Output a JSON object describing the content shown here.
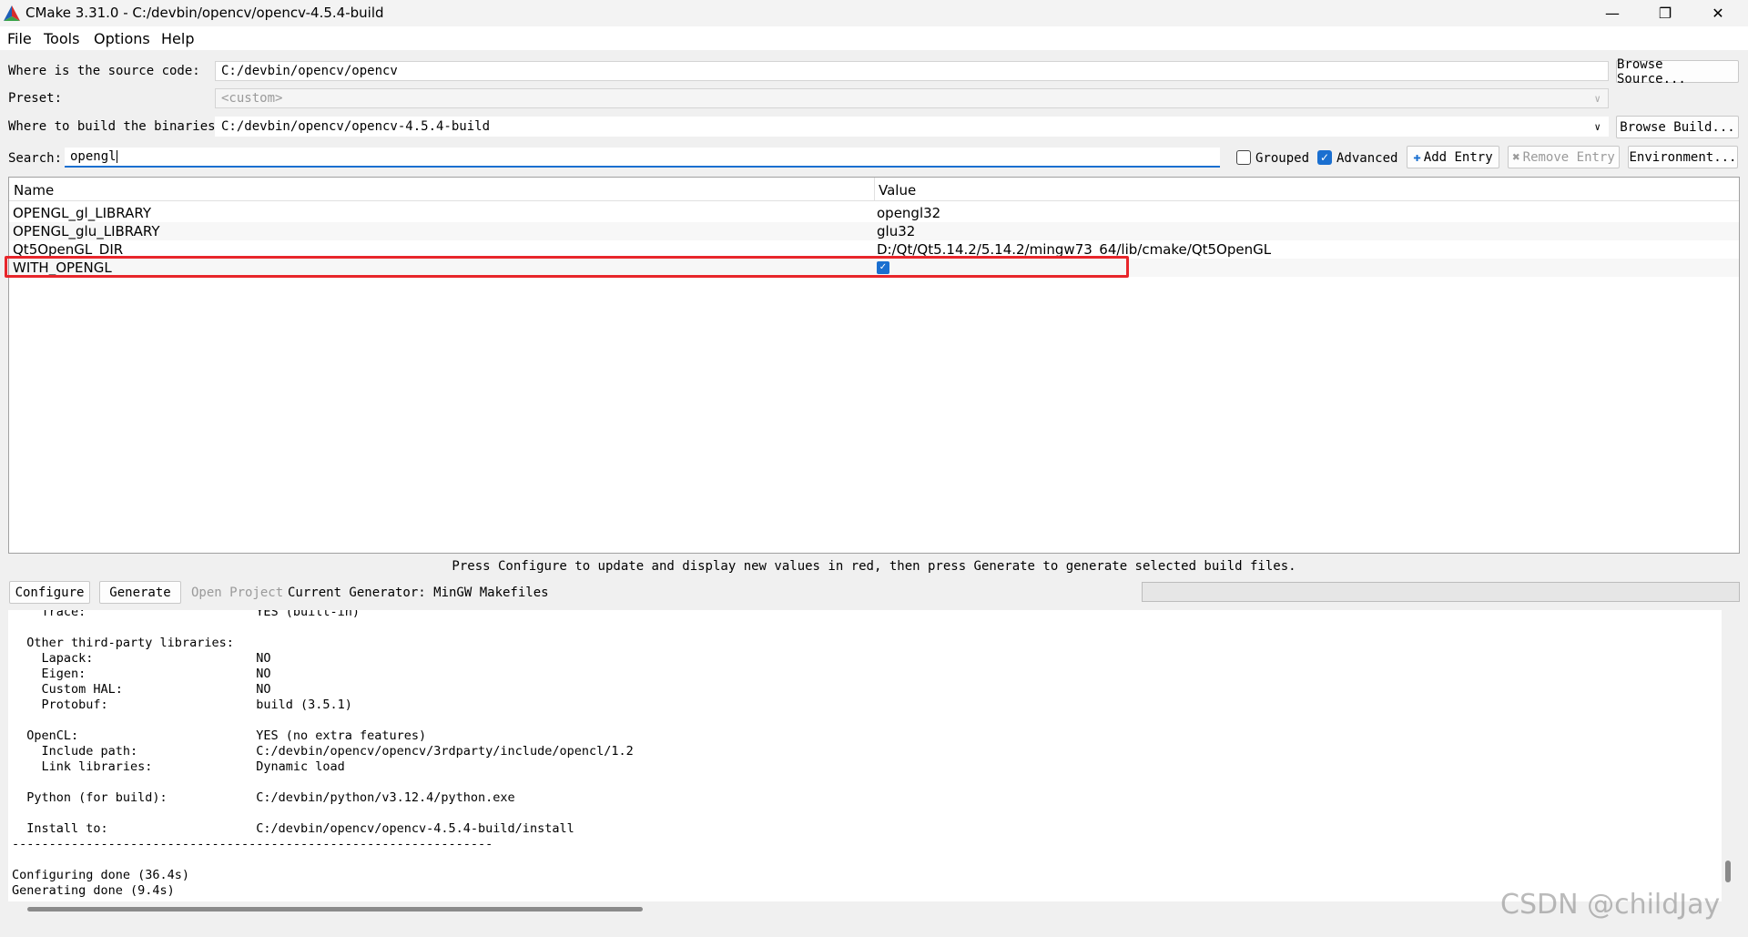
{
  "window": {
    "title": "CMake 3.31.0 - C:/devbin/opencv/opencv-4.5.4-build",
    "minimize_glyph": "—",
    "restore_glyph": "❐",
    "close_glyph": "✕"
  },
  "menubar": {
    "file": "File",
    "tools": "Tools",
    "options": "Options",
    "help": "Help"
  },
  "source": {
    "label": "Where is the source code:",
    "value": "C:/devbin/opencv/opencv",
    "browse": "Browse Source..."
  },
  "preset": {
    "label": "Preset:",
    "value": "<custom>"
  },
  "build": {
    "label": "Where to build the binaries:",
    "value": "C:/devbin/opencv/opencv-4.5.4-build",
    "browse": "Browse Build..."
  },
  "search": {
    "label": "Search:",
    "value": "opengl",
    "grouped_label": "Grouped",
    "grouped_checked": false,
    "advanced_label": "Advanced",
    "advanced_checked": true,
    "add_entry": "Add Entry",
    "remove_entry": "Remove Entry",
    "environment": "Environment..."
  },
  "table": {
    "columns": {
      "name": "Name",
      "value": "Value"
    },
    "rows": [
      {
        "name": "OPENGL_gl_LIBRARY",
        "value": "opengl32"
      },
      {
        "name": "OPENGL_glu_LIBRARY",
        "value": "glu32"
      },
      {
        "name": "Qt5OpenGL_DIR",
        "value": "D:/Qt/Qt5.14.2/5.14.2/mingw73_64/lib/cmake/Qt5OpenGL"
      },
      {
        "name": "WITH_OPENGL",
        "value_checked": true
      }
    ]
  },
  "status": {
    "hint": "Press Configure to update and display new values in red, then press Generate to generate selected build files."
  },
  "actions": {
    "configure": "Configure",
    "generate": "Generate",
    "open_project": "Open Project",
    "current_generator": "Current Generator: MinGW Makefiles"
  },
  "log": {
    "lines": [
      "    Trace:                       YES (built-in)",
      "",
      "  Other third-party libraries:",
      "    Lapack:                      NO",
      "    Eigen:                       NO",
      "    Custom HAL:                  NO",
      "    Protobuf:                    build (3.5.1)",
      "",
      "  OpenCL:                        YES (no extra features)",
      "    Include path:                C:/devbin/opencv/opencv/3rdparty/include/opencl/1.2",
      "    Link libraries:              Dynamic load",
      "",
      "  Python (for build):            C:/devbin/python/v3.12.4/python.exe",
      "",
      "  Install to:                    C:/devbin/opencv/opencv-4.5.4-build/install",
      "-----------------------------------------------------------------",
      "",
      "Configuring done (36.4s)",
      "Generating done (9.4s)"
    ]
  },
  "watermark": "CSDN @childJay",
  "colors": {
    "highlight": "#e8262b",
    "accent": "#1a6fd0",
    "bg": "#f0f0f0"
  }
}
